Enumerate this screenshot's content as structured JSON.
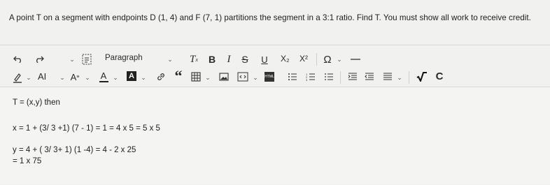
{
  "question": "A point T on a segment with endpoints D (1, 4) and F (7, 1) partitions the segment in a 3:1 ratio. Find T. You must show all work to receive credit.",
  "toolbar": {
    "paragraph_label": "Paragraph",
    "bold_label": "B",
    "italic_label": "I",
    "strike_label": "S",
    "underline_label": "U",
    "subscript_label": "X₂",
    "superscript_label": "X²",
    "omega_label": "Ω",
    "font_size_label": "AI",
    "text_color_label": "A",
    "quote_label": "“",
    "clear_format_label": "Tx",
    "icons": [
      "undo-icon",
      "redo-icon",
      "fullscreen-icon",
      "clear-format-icon",
      "special-char-icon",
      "horizontal-rule-icon",
      "highlight-icon",
      "font-size-icon",
      "text-size-icon",
      "text-color-icon",
      "background-color-icon",
      "link-icon",
      "blockquote-icon",
      "table-icon",
      "image-icon",
      "media-icon",
      "html-icon",
      "ordered-list-icon",
      "bullet-list-icon",
      "outdent-list-icon",
      "indent-icon",
      "outdent-icon",
      "align-icon",
      "sqrt-icon",
      "chemistry-icon"
    ]
  },
  "content": {
    "line1": "T = (x,y) then",
    "line2": "x = 1 + (3/ 3 +1) (7 - 1) = 1 = 4 x 5 = 5 x 5",
    "line3": "y = 4 + ( 3/ 3+ 1) (1 -4) = 4 - 2 x 25",
    "line4": "= 1 x 75"
  }
}
